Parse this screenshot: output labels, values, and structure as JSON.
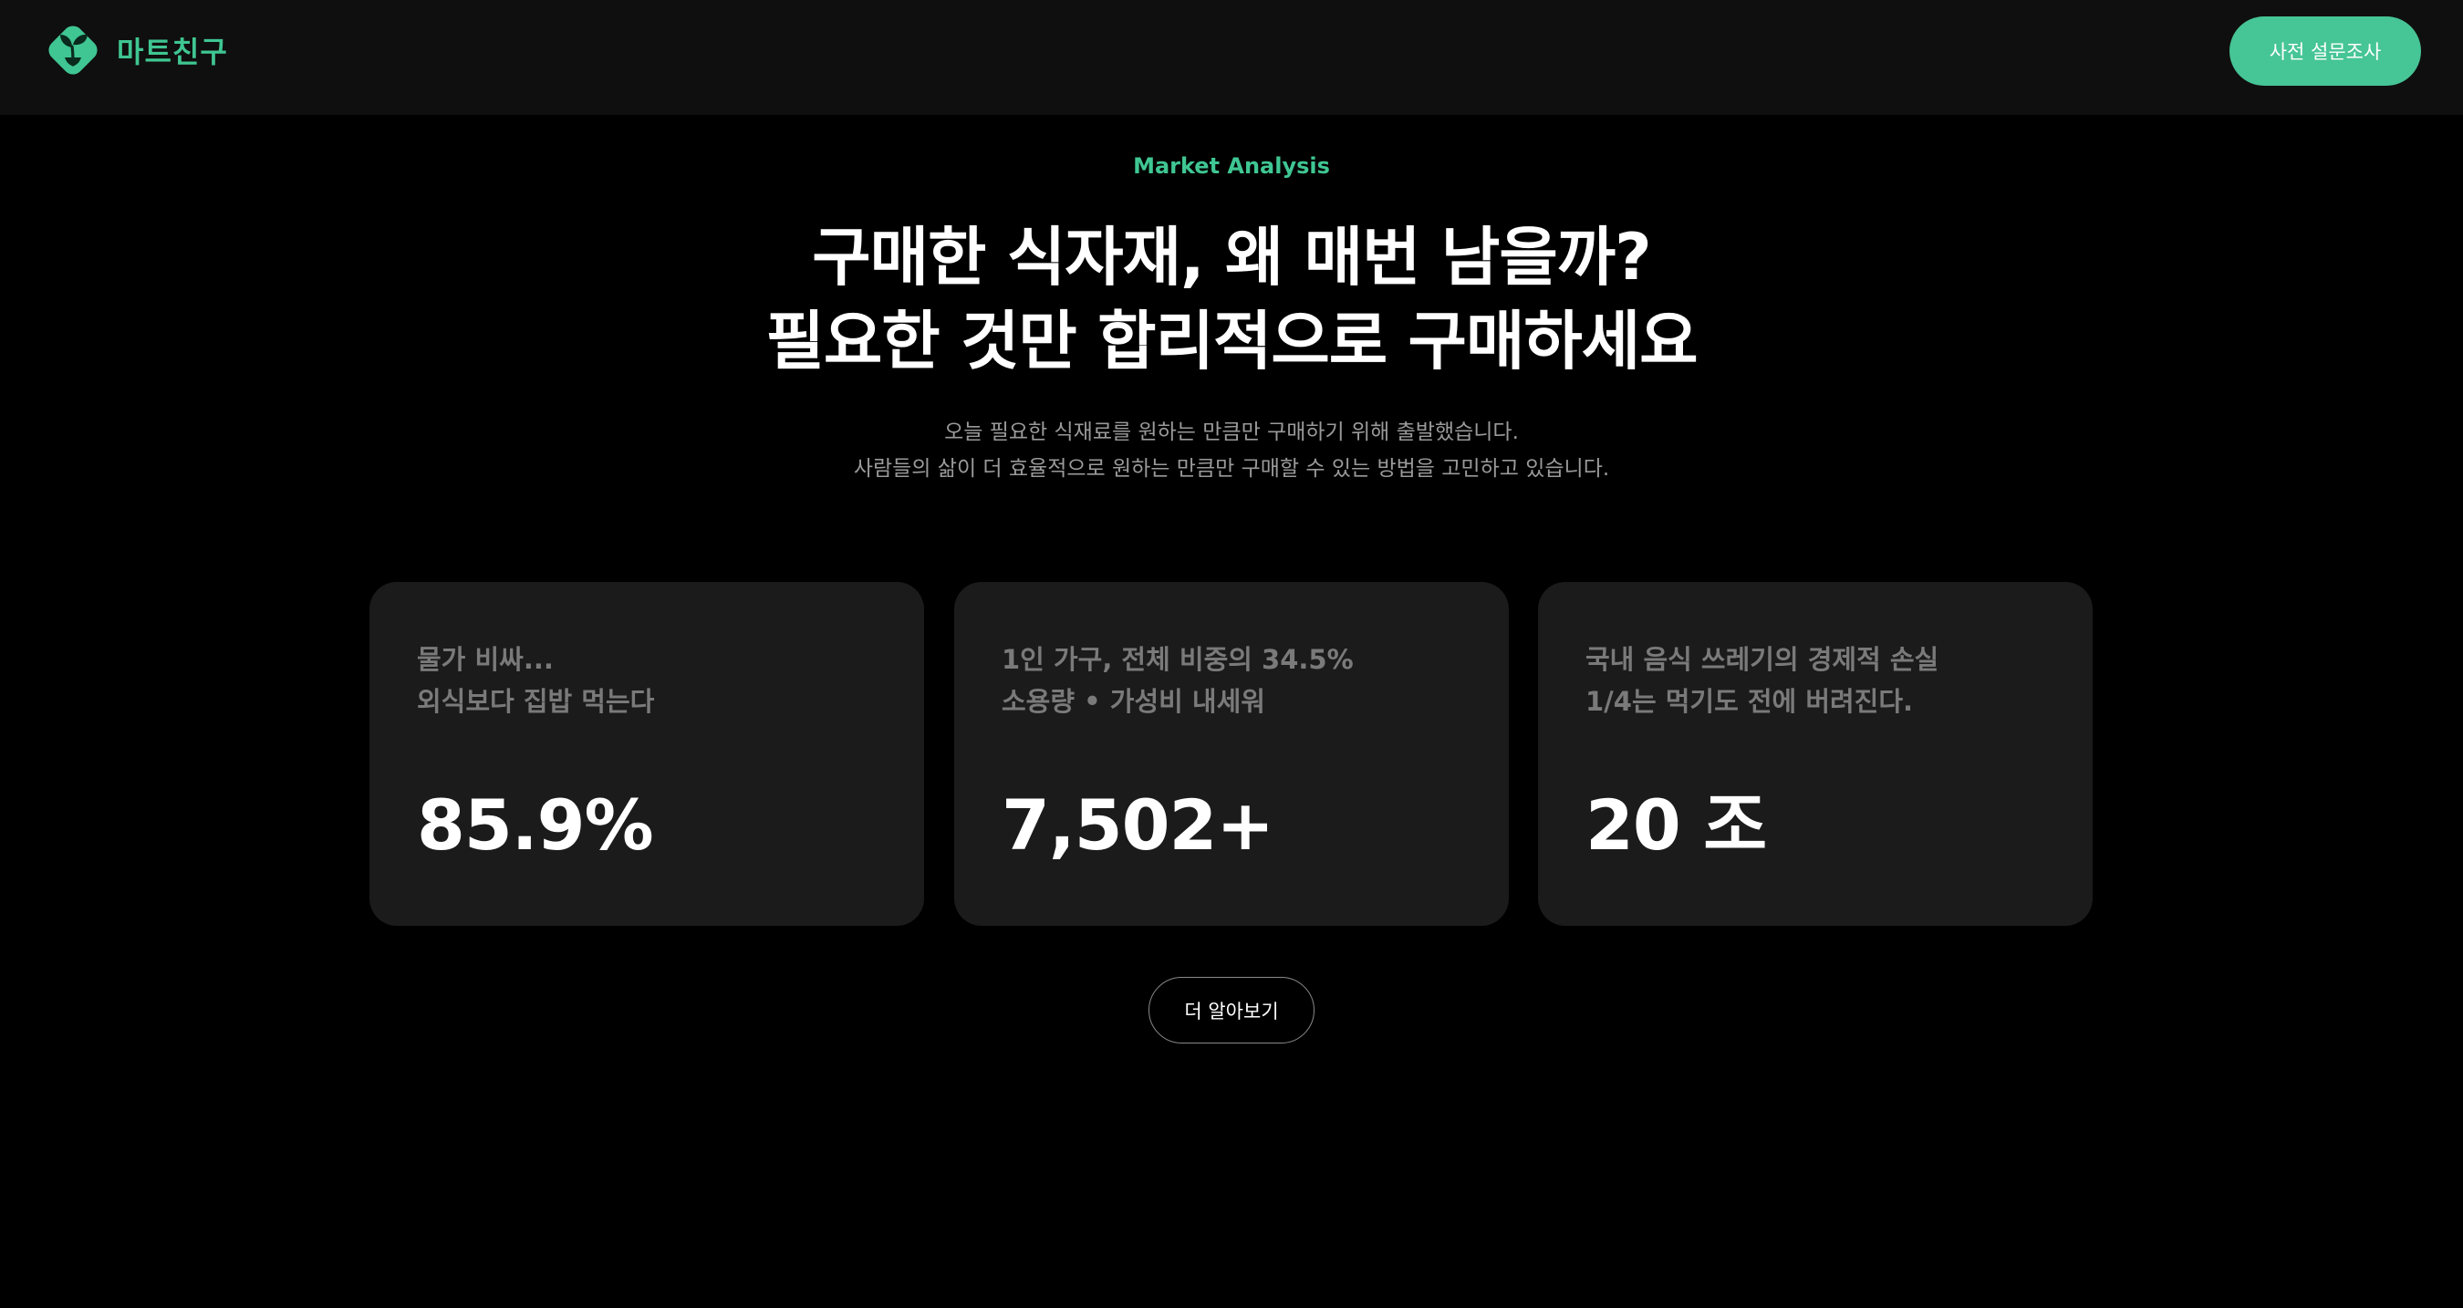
{
  "header": {
    "logo_text": "마트친구",
    "survey_button_label": "사전 설문조사"
  },
  "hero": {
    "eyebrow": "Market Analysis",
    "headline_line1": "구매한 식자재, 왜 매번 남을까?",
    "headline_line2": "필요한 것만 합리적으로 구매하세요",
    "subtext_line1": "오늘 필요한 식재료를 원하는 만큼만 구매하기 위해 출발했습니다.",
    "subtext_line2": "사람들의 삶이 더 효율적으로 원하는 만큼만 구매할 수 있는 방법을 고민하고 있습니다."
  },
  "stats": [
    {
      "caption_line1": "물가 비싸...",
      "caption_line2": "외식보다 집밥 먹는다",
      "value": "85.9%"
    },
    {
      "caption_line1": "1인 가구, 전체 비중의 34.5%",
      "caption_line2": "소용량 • 가성비 내세워",
      "value": "7,502+"
    },
    {
      "caption_line1": "국내 음식 쓰레기의 경제적 손실",
      "caption_line2": "1/4는 먹기도 전에 버려진다.",
      "value": "20 조"
    }
  ],
  "cta": {
    "learn_more_label": "더 알아보기"
  },
  "colors": {
    "accent": "#46c596",
    "background": "#000000",
    "header_bg": "#0f0f0f",
    "card_bg": "#1b1b1b"
  },
  "icons": {
    "logo": "sprout-leaf-icon"
  }
}
